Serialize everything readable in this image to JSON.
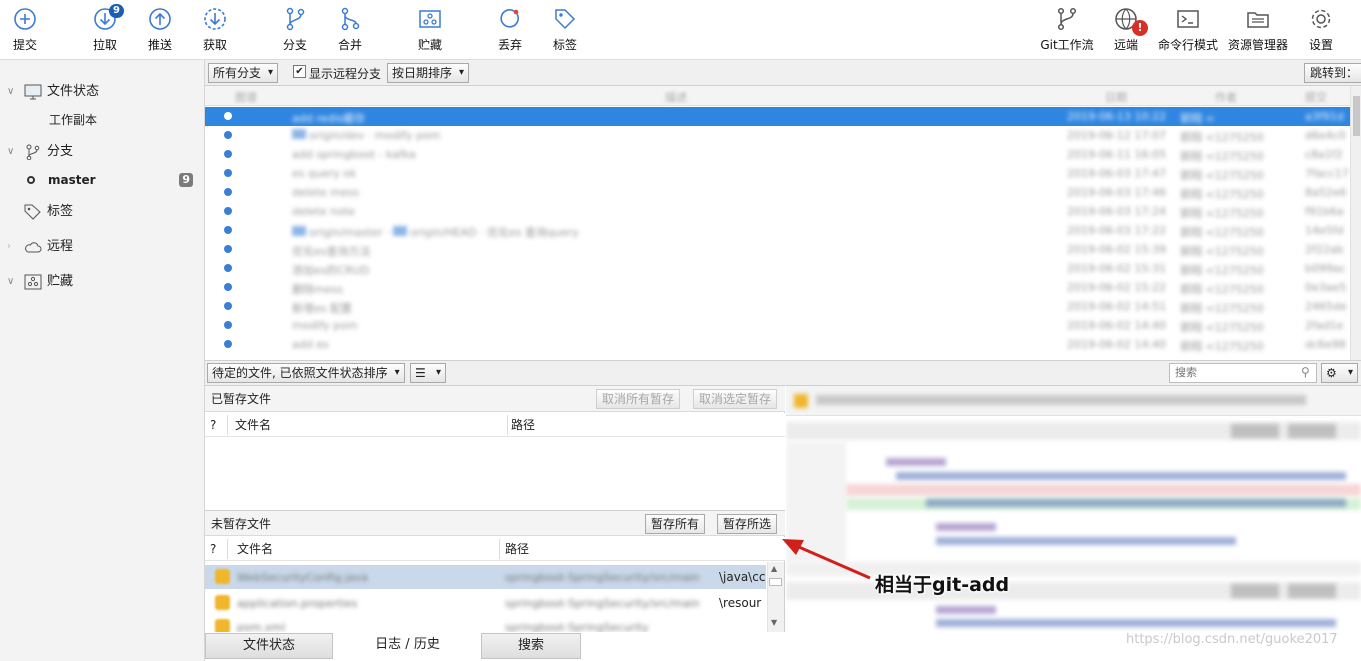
{
  "toolbar": {
    "commit": "提交",
    "pull": "拉取",
    "pull_badge": "9",
    "push": "推送",
    "fetch": "获取",
    "branch": "分支",
    "merge": "合并",
    "stash": "贮藏",
    "discard": "丢弃",
    "tag": "标签",
    "git_flow": "Git工作流",
    "remote": "远端",
    "remote_alert": "!",
    "terminal": "命令行模式",
    "explorer": "资源管理器",
    "settings": "设置"
  },
  "sidebar": {
    "workspace": "文件状态",
    "working_copy": "工作副本",
    "branches": "分支",
    "current_branch": "master",
    "branch_count": "9",
    "tags": "标签",
    "remotes": "远程",
    "stashes": "贮藏"
  },
  "filterbar": {
    "branches_dropdown": "所有分支",
    "show_remote_checked": true,
    "show_remote_label": "显示远程分支",
    "sort_dropdown": "按日期排序",
    "jump_to": "跳转到："
  },
  "midbar": {
    "file_sort": "待定的文件, 已依照文件状态排序",
    "search_placeholder": "搜索"
  },
  "staged": {
    "title": "已暂存文件",
    "unstage_all": "取消所有暂存",
    "unstage_selected": "取消选定暂存",
    "col_q": "?",
    "col_name": "文件名",
    "col_path": "路径"
  },
  "unstaged": {
    "title": "未暂存文件",
    "stage_all": "暂存所有",
    "stage_selected": "暂存所选",
    "col_q": "?",
    "col_name": "文件名",
    "col_path": "路径",
    "rows": [
      {
        "path_tail": "\\java\\cc"
      },
      {
        "path_tail": "\\resour"
      },
      {
        "path_tail": ""
      }
    ]
  },
  "tabs": {
    "file_status": "文件状态",
    "log_history": "日志 / 历史",
    "search": "搜索"
  },
  "annotation": "相当于git-add",
  "watermark": "https://blog.csdn.net/guoke2017",
  "colors": {
    "selection": "#2f86e0",
    "annotation_arrow": "#d0201c",
    "alert": "#d93025",
    "badge": "#1a5fb4"
  }
}
